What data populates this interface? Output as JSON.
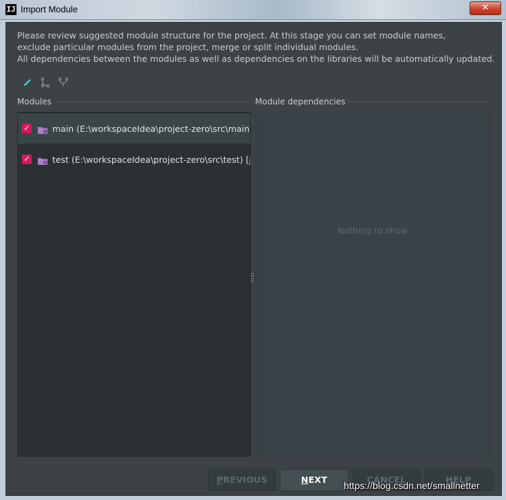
{
  "window": {
    "title": "Import Module",
    "app_icon_text": "IJ",
    "close_label": "✕"
  },
  "description": {
    "line1": "Please review suggested module structure for the project. At this stage you can set module names,",
    "line2": "exclude particular modules from the project, merge or split individual modules.",
    "line3": "All dependencies between the modules as well as dependencies on the libraries will be automatically updated."
  },
  "toolbar": {
    "icons": [
      "edit-icon",
      "split-icon",
      "merge-icon"
    ]
  },
  "modules": {
    "header": "Modules",
    "items": [
      {
        "label": "main (E:\\workspaceIdea\\project-zero\\src\\main) [j",
        "checked": true,
        "selected": true
      },
      {
        "label": "test (E:\\workspaceIdea\\project-zero\\src\\test) [java",
        "checked": true,
        "selected": false
      }
    ]
  },
  "dependencies": {
    "header": "Module dependencies",
    "empty_text": "Nothing to show"
  },
  "buttons": {
    "previous": {
      "mnemonic": "P",
      "rest": "REVIOUS"
    },
    "next": {
      "mnemonic": "N",
      "rest": "EXT"
    },
    "cancel": "CANCEL",
    "help": "HELP"
  },
  "watermark": "https://blog.csdn.net/smallnetter",
  "colors": {
    "checkbox": "#d6195d",
    "background": "#3c4245",
    "panel": "#2b3033"
  }
}
